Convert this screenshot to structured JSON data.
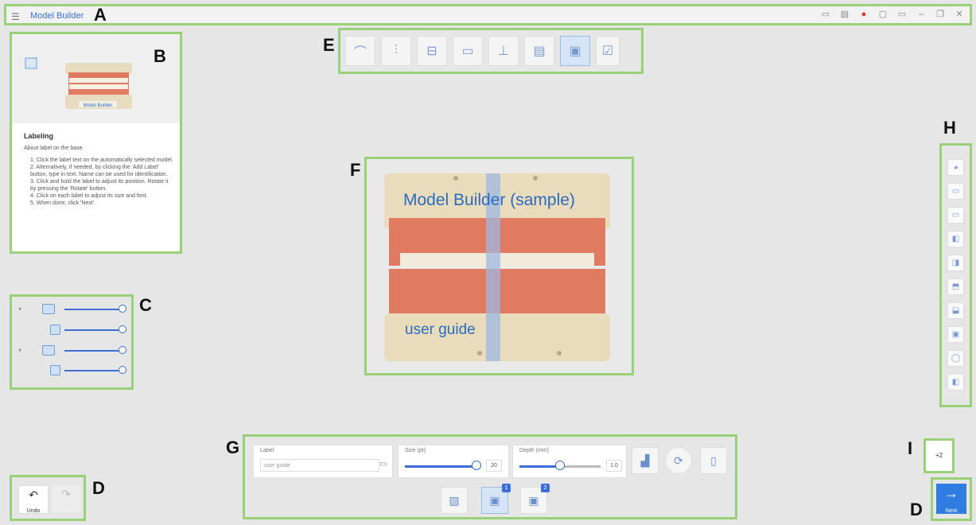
{
  "labels": {
    "a": "A",
    "b": "B",
    "c": "C",
    "d1": "D",
    "d2": "D",
    "e": "E",
    "f": "F",
    "g": "G",
    "h": "H",
    "i": "I"
  },
  "titlebar": {
    "title": "Model Builder"
  },
  "guide": {
    "image_caption": "Model Builder",
    "heading": "Labeling",
    "intro": "About label on the base.",
    "steps": [
      "1. Click the label text on the automatically selected model.",
      "2. Alternatively, if needed, by clicking the 'Add Label' button, type in text. Name can be used for identification.",
      "3. Click and hold the label to adjust its position. Rotate it by pressing the 'Rotate' button.",
      "4. Click on each label to adjust its size and font.",
      "5. When done, click 'Next'."
    ]
  },
  "viewport": {
    "header_text": "Model Builder (sample)",
    "footer_text": "user guide"
  },
  "props": {
    "label_title": "Label",
    "label_value": "user guide",
    "size_title": "Size (pt)",
    "size_value": "20",
    "depth_title": "Depth (mm)",
    "depth_value": "1.0",
    "badge1": "1",
    "badge2": "2"
  },
  "undo": {
    "label": "Undo"
  },
  "next": {
    "label": "Next"
  },
  "zoom": {
    "value": "+2"
  },
  "colors": {
    "accent": "#3b6fd6",
    "highlight": "#9bd07a",
    "next": "#2f7de1"
  }
}
